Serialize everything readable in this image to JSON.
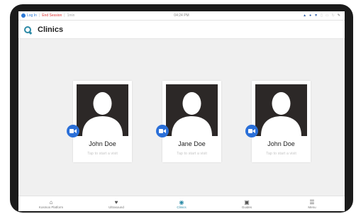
{
  "status_bar": {
    "login_label": "Log In",
    "end_session_label": "End Session",
    "timer": "1min",
    "time": "04:24 PM",
    "icons": [
      "bluetooth-icon",
      "location-icon",
      "wifi-icon",
      "lock-icon",
      "battery-icon",
      "sync-icon",
      "settings-icon"
    ]
  },
  "app_bar": {
    "title": "Clinics"
  },
  "clinics": [
    {
      "name": "John Doe",
      "hint": "Tap to start a visit"
    },
    {
      "name": "Jane Doe",
      "hint": "Tap to start a visit"
    },
    {
      "name": "John Doe",
      "hint": "Tap to start a visit"
    }
  ],
  "bottom_nav": [
    {
      "label": "Kosmos Platform",
      "icon": "home-icon",
      "glyph": "⌂",
      "active": false
    },
    {
      "label": "Ultrasound",
      "icon": "heart-icon",
      "glyph": "♥",
      "active": false
    },
    {
      "label": "Clinics",
      "icon": "clinic-icon",
      "glyph": "◉",
      "active": true
    },
    {
      "label": "Guides",
      "icon": "guide-icon",
      "glyph": "▣",
      "active": false
    },
    {
      "label": "Menu",
      "icon": "menu-icon",
      "glyph": "☰",
      "active": false
    }
  ],
  "colors": {
    "accent": "#2a8aa6",
    "camera": "#2a6fd8",
    "end_session": "#dd3333"
  }
}
